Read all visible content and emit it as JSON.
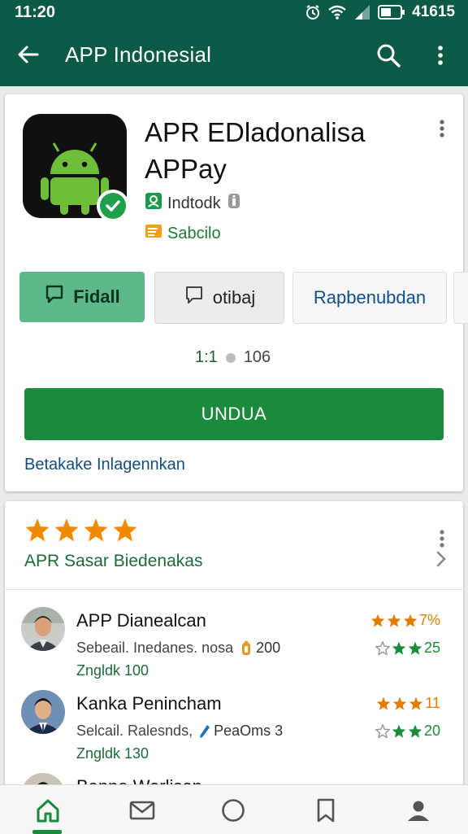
{
  "status": {
    "time": "11:20",
    "battery_text": "41615"
  },
  "appbar": {
    "title": "APP Indonesial"
  },
  "app": {
    "name_line1": "APR EDladonalisa",
    "name_line2": "APPay",
    "developer": "Indtodk",
    "category": "Sabcilo"
  },
  "actions": [
    {
      "label": "Fidall"
    },
    {
      "label": "otibaj"
    },
    {
      "label": "Rapbenubdan"
    }
  ],
  "stats": {
    "rating": "1:1",
    "count": "106"
  },
  "install_label": "UNDUA",
  "read_more": "Betakake Inlagennkan",
  "reviews_section": {
    "stars": 4,
    "title": "APR Sasar Biedenakas"
  },
  "reviews": [
    {
      "name": "APP Dianealcan",
      "sub": "Sebeail. Inedanes. nosa",
      "badge": "200",
      "likes": "Zngldk 100",
      "rating_a": "7%",
      "rating_b": "25"
    },
    {
      "name": "Kanka Penincham",
      "sub": "Selcail. Ralesnds,",
      "badge": "PeaOms 3",
      "likes": "Zngldk 130",
      "rating_a": "11",
      "rating_b": "20"
    },
    {
      "name": "Banna Worlison"
    }
  ],
  "colors": {
    "appbar": "#0a5a46",
    "primary": "#1a8a3c",
    "accent_star": "#f08a00"
  },
  "bottom_nav": [
    "home-icon",
    "mail-icon",
    "circle-icon",
    "bookmark-icon",
    "profile-icon"
  ]
}
